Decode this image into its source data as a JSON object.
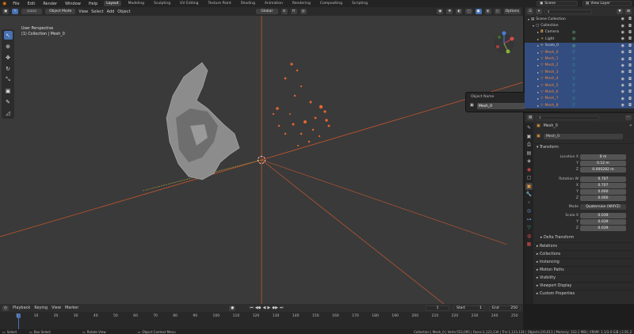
{
  "topbar": {
    "menus": [
      "File",
      "Edit",
      "Render",
      "Window",
      "Help"
    ],
    "workspaces": [
      "Layout",
      "Modeling",
      "Sculpting",
      "UV Editing",
      "Texture Paint",
      "Shading",
      "Animation",
      "Rendering",
      "Compositing",
      "Scripting"
    ],
    "scene": "Scene",
    "view_layer": "View Layer"
  },
  "viewport": {
    "mode": "Object Mode",
    "menus": [
      "View",
      "Select",
      "Add",
      "Object"
    ],
    "transform_orientation": "Global",
    "options": "Options",
    "overlay_title": "User Perspective",
    "overlay_subtitle": "(1) Collection | Mesh_0"
  },
  "object_popup": {
    "title": "Object Name",
    "value": "Mesh_0"
  },
  "outliner": {
    "rows": [
      {
        "label": "Scene Collection",
        "indent": 0,
        "selected": false,
        "icon": "scene-collection-icon"
      },
      {
        "label": "Collection",
        "indent": 1,
        "selected": false,
        "icon": "collection-icon"
      },
      {
        "label": "Camera",
        "indent": 2,
        "selected": false,
        "icon": "camera-icon"
      },
      {
        "label": "Light",
        "indent": 2,
        "selected": false,
        "icon": "light-icon"
      },
      {
        "label": "Scale_0",
        "indent": 2,
        "selected": true,
        "icon": "empty-icon"
      },
      {
        "label": "Mesh_0",
        "indent": 2,
        "selected": true,
        "icon": "mesh-icon"
      },
      {
        "label": "Mesh_1",
        "indent": 2,
        "selected": true,
        "icon": "mesh-icon"
      },
      {
        "label": "Mesh_2",
        "indent": 2,
        "selected": true,
        "icon": "mesh-icon"
      },
      {
        "label": "Mesh_3",
        "indent": 2,
        "selected": true,
        "icon": "mesh-icon"
      },
      {
        "label": "Mesh_4",
        "indent": 2,
        "selected": true,
        "icon": "mesh-icon"
      },
      {
        "label": "Mesh_5",
        "indent": 2,
        "selected": true,
        "icon": "mesh-icon"
      },
      {
        "label": "Mesh_6",
        "indent": 2,
        "selected": true,
        "icon": "mesh-icon"
      },
      {
        "label": "Mesh_7",
        "indent": 2,
        "selected": true,
        "icon": "mesh-icon"
      },
      {
        "label": "Mesh_8",
        "indent": 2,
        "selected": true,
        "icon": "mesh-icon"
      }
    ]
  },
  "properties": {
    "object_name": "Mesh_0",
    "name_field": "Mesh_0",
    "transform_label": "Transform",
    "location": {
      "x_label": "Location X",
      "x": "0 m",
      "y_label": "Y",
      "y": "0.12 m",
      "z_label": "Z",
      "z": "0.000282 m"
    },
    "rotation": {
      "w_label": "Rotation W",
      "w": "0.707",
      "x_label": "X",
      "x": "0.707",
      "y_label": "Y",
      "y": "0.000",
      "z_label": "Z",
      "z": "0.000"
    },
    "mode_label": "Mode",
    "mode": "Quaternion (WXYZ)",
    "scale": {
      "x_label": "Scale X",
      "x": "0.039",
      "y_label": "Y",
      "y": "0.039",
      "z_label": "Z",
      "z": "0.039"
    },
    "delta_transform": "Delta Transform",
    "sections": [
      "Relations",
      "Collections",
      "Instancing",
      "Motion Paths",
      "Visibility",
      "Viewport Display",
      "Custom Properties"
    ]
  },
  "timeline": {
    "menus": [
      "Playback",
      "Keying",
      "View",
      "Marker"
    ],
    "current_frame": "1",
    "start_label": "Start",
    "start": "1",
    "end_label": "End",
    "end": "250",
    "ticks": [
      "1",
      "10",
      "20",
      "30",
      "40",
      "50",
      "60",
      "70",
      "80",
      "90",
      "100",
      "110",
      "120",
      "130",
      "140",
      "150",
      "160",
      "170",
      "180",
      "190",
      "200",
      "210",
      "220",
      "230",
      "240",
      "250"
    ]
  },
  "statusbar": {
    "select": "Select",
    "box_select": "Box Select",
    "rotate_view": "Rotate View",
    "context_menu": "Object Context Menu",
    "stats": "Collection | Mesh_0 | Verts:552,095 | Faces:1,123,134 | Tris:1,123,134 | Objects:2/0,013 | Memory: 333.1 MiB | VRAM: 1.1/3.0 GiB | 2.91.2"
  },
  "colors": {
    "accent": "#4772b3",
    "selection_row": "#334d80",
    "axis_x": "#d8542b",
    "axis_y": "#a3a33a",
    "mesh_highlight": "#f07030"
  }
}
